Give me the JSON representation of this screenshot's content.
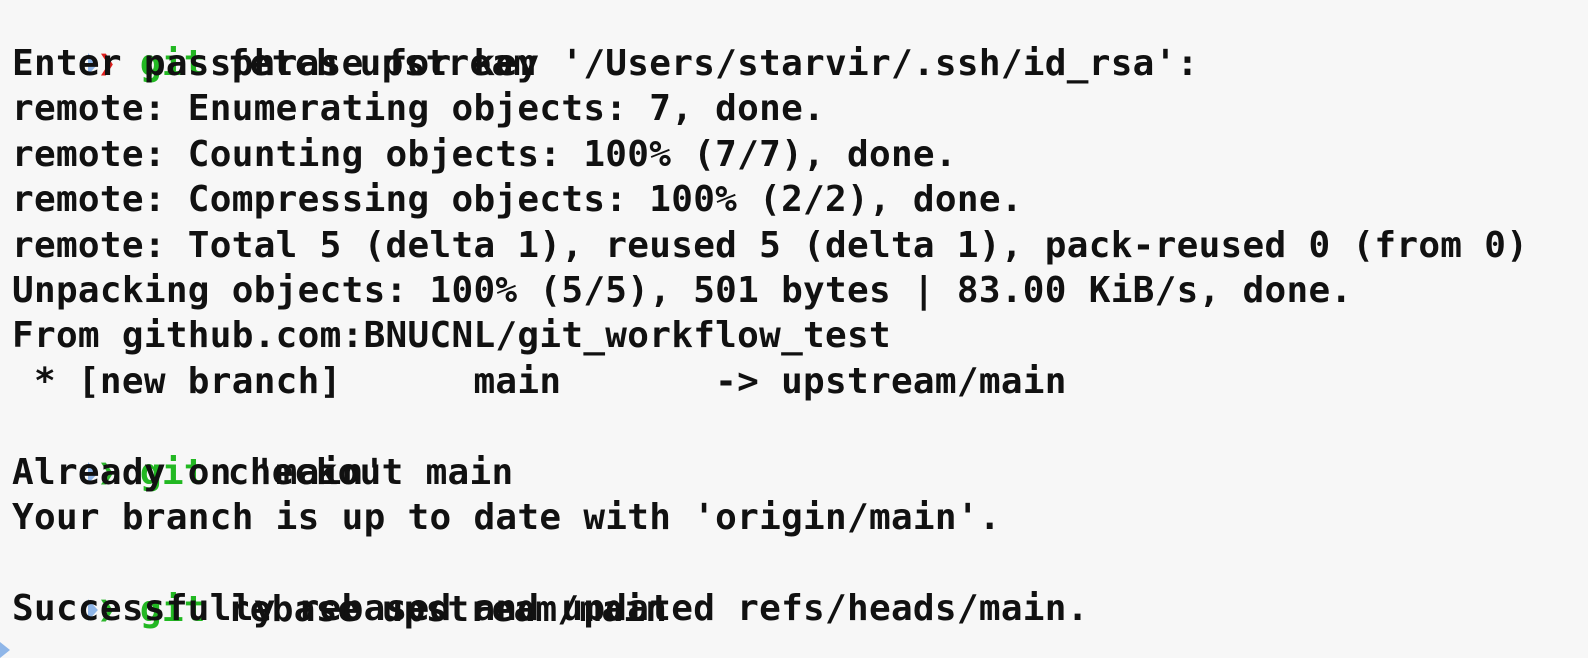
{
  "colors": {
    "background": "#f7f7f7",
    "text": "#111111",
    "git_keyword": "#22b822",
    "prompt_error": "#e0201e",
    "prompt_ok": "#2bb52b",
    "prompt_marker": "#8fb6e8"
  },
  "prompt_symbol": "❯",
  "commands": [
    {
      "keyword": "git",
      "rest": " fetch upstream",
      "status": "error"
    },
    {
      "keyword": "git",
      "rest": " checkout main",
      "status": "ok"
    },
    {
      "keyword": "git",
      "rest": " rebase upstream/main",
      "status": "ok"
    }
  ],
  "output": {
    "fetch": [
      "Enter passphrase for key '/Users/starvir/.ssh/id_rsa':",
      "remote: Enumerating objects: 7, done.",
      "remote: Counting objects: 100% (7/7), done.",
      "remote: Compressing objects: 100% (2/2), done.",
      "remote: Total 5 (delta 1), reused 5 (delta 1), pack-reused 0 (from 0)",
      "Unpacking objects: 100% (5/5), 501 bytes | 83.00 KiB/s, done.",
      "From github.com:BNUCNL/git_workflow_test",
      " * [new branch]      main       -> upstream/main"
    ],
    "checkout": [
      "Already on 'main'",
      "Your branch is up to date with 'origin/main'."
    ],
    "rebase": [
      "Successfully rebased and updated refs/heads/main."
    ]
  }
}
